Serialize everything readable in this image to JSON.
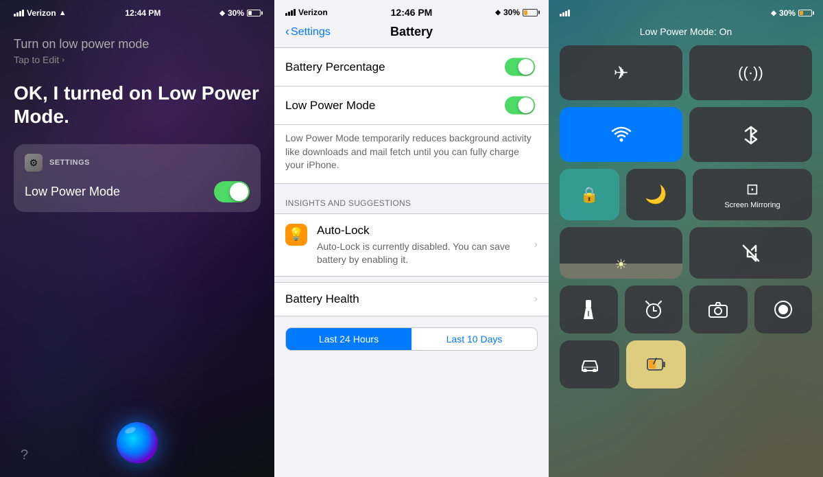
{
  "siri": {
    "statusBar": {
      "carrier": "Verizon",
      "time": "12:44 PM",
      "battery": "30%"
    },
    "query": "Turn on low power mode",
    "tapToEdit": "Tap to Edit",
    "response": "OK, I turned on Low Power Mode.",
    "card": {
      "header": "SETTINGS",
      "rowLabel": "Low Power Mode"
    },
    "questionMark": "?"
  },
  "settings": {
    "statusBar": {
      "carrier": "Verizon",
      "time": "12:46 PM",
      "battery": "30%"
    },
    "backLabel": "Settings",
    "title": "Battery",
    "rows": [
      {
        "label": "Battery Percentage",
        "toggle": true,
        "on": true
      },
      {
        "label": "Low Power Mode",
        "toggle": true,
        "on": true
      }
    ],
    "lowPowerDesc": "Low Power Mode temporarily reduces background activity like downloads and mail fetch until you can fully charge your iPhone.",
    "insightsSectionHeader": "INSIGHTS AND SUGGESTIONS",
    "insights": [
      {
        "icon": "💡",
        "title": "Auto-Lock",
        "desc": "Auto-Lock is currently disabled. You can save battery by enabling it.",
        "hasChevron": true
      }
    ],
    "batteryHealth": "Battery Health",
    "timeTabs": [
      "Last 24 Hours",
      "Last 10 Days"
    ],
    "activeTab": 0
  },
  "controlCenter": {
    "statusBar": {
      "carrier": "",
      "time": "",
      "battery": "30%"
    },
    "headerLabel": "Low Power Mode: On",
    "tiles": {
      "airplane": "✈",
      "wifi_signal": "((·))",
      "wifi": "WiFi",
      "bluetooth": "Bluetooth",
      "rotation_lock": "🔒",
      "do_not_disturb": "🌙",
      "screen_mirror": "Screen Mirroring",
      "brightness": "☀",
      "mute": "🔇",
      "flashlight": "🔦",
      "clock": "⏰",
      "camera": "📷",
      "record": "⏺",
      "car": "🚗",
      "battery_status": "🔋"
    }
  }
}
